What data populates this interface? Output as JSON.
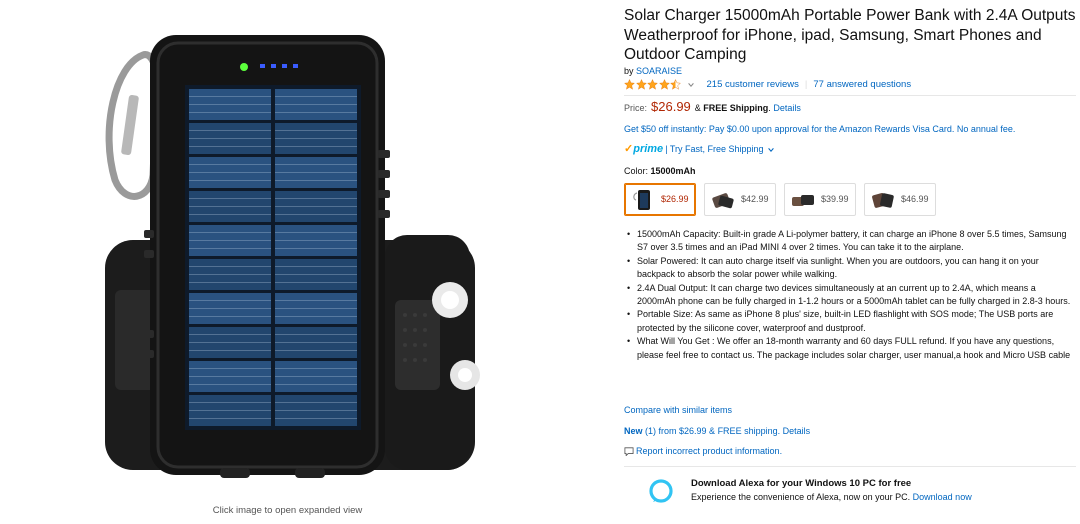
{
  "image": {
    "caption": "Click image to open expanded view"
  },
  "product": {
    "title": "Solar Charger 15000mAh Portable Power Bank with 2.4A Outputs Weatherproof for iPhone, ipad, Samsung, Smart Phones and Outdoor Camping",
    "by_prefix": "by ",
    "brand": "SOARAISE",
    "rating_stars": 4.5,
    "review_count": "215 customer reviews",
    "answered": "77 answered questions",
    "price_label": "Price:",
    "price": "$26.99",
    "shipping_prefix": "& ",
    "shipping_bold": "FREE Shipping",
    "shipping_suffix": ".",
    "shipping_details": "Details",
    "promo": "Get $50 off instantly: Pay $0.00 upon approval for the Amazon Rewards Visa Card. No annual fee.",
    "prime_label": "prime",
    "prime_text": "| Try Fast, Free Shipping",
    "color_label": "Color:",
    "color_value": "15000mAh",
    "swatches": [
      {
        "price": "$26.99",
        "selected": true
      },
      {
        "price": "$42.99",
        "selected": false
      },
      {
        "price": "$39.99",
        "selected": false
      },
      {
        "price": "$46.99",
        "selected": false
      }
    ],
    "bullets": [
      "15000mAh Capacity: Built-in grade A Li-polymer battery, it can charge an iPhone 8 over 5.5 times, Samsung S7 over 3.5 times and an iPad MINI 4 over 2 times. You can take it to the airplane.",
      "Solar Powered: It can auto charge itself via sunlight. When you are outdoors, you can hang it on your backpack to absorb the solar power while walking.",
      "2.4A Dual Output: It can charge two devices simultaneously at an current up to 2.4A, which means a 2000mAh phone can be fully charged in 1-1.2 hours or a 5000mAh tablet can be fully charged in 2.8-3 hours.",
      "Portable Size: As same as iPhone 8 plus' size, built-in LED flashlight with SOS mode; The USB ports are protected by the silicone cover, waterproof and dustproof.",
      "What Will You Get : We offer an 18-month warranty and 60 days FULL refund. If you have any questions, please feel free to contact us. The package includes solar charger, user manual,a hook and Micro USB cable"
    ],
    "compare": "Compare with similar items",
    "new_label": "New",
    "new_text": "(1) from $26.99 & FREE shipping.",
    "new_details": "Details",
    "report": "Report incorrect product information."
  },
  "alexa": {
    "title": "Download Alexa for your Windows 10 PC for free",
    "sub": "Experience the convenience of Alexa, now on your PC.",
    "link": "Download now"
  },
  "colors": {
    "link": "#0066c0",
    "price": "#b12704",
    "star": "#ffa41c",
    "selected_border": "#e77600",
    "prime": "#00a8e1"
  }
}
